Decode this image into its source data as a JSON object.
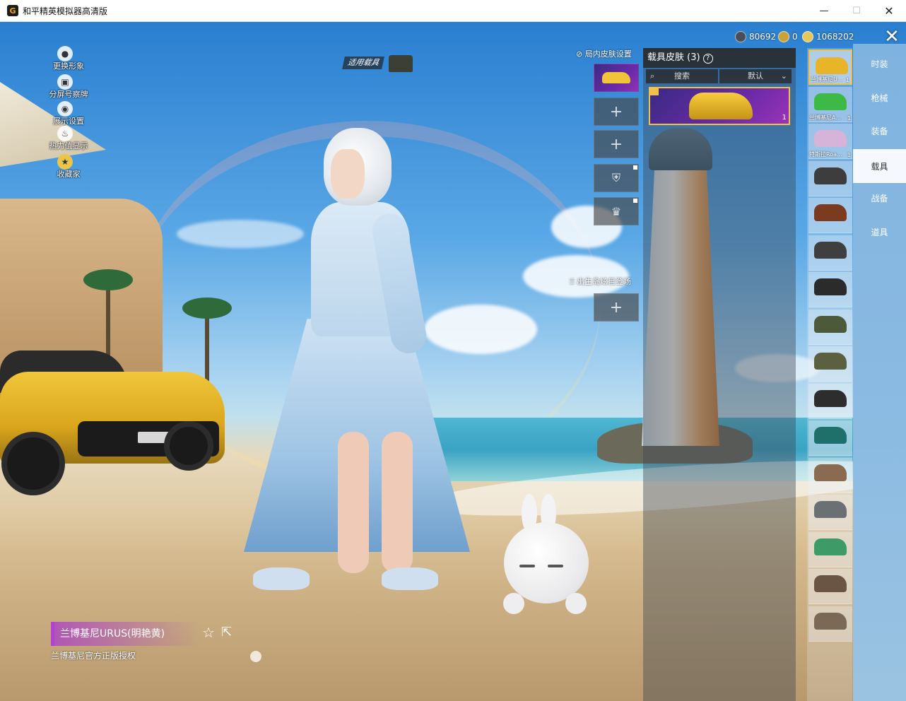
{
  "window": {
    "title": "和平精英模拟器高清版",
    "app_icon_glyph": "G",
    "minimize_glyph": "—",
    "maximize_glyph": "☐",
    "close_glyph": "✕"
  },
  "left_menu": [
    {
      "label": "更换形象",
      "icon": "person-icon"
    },
    {
      "label": "分屏号察牌",
      "icon": "display-icon"
    },
    {
      "label": "展示设置",
      "icon": "eye-icon"
    },
    {
      "label": "热力值显示",
      "icon": "flame-icon"
    },
    {
      "label": "收藏家",
      "icon": "collector-icon"
    }
  ],
  "apply_vehicle_tag": "适用载具",
  "currency": {
    "currency_1": "80692",
    "currency_2": "0",
    "currency_3": "1068202"
  },
  "slots": {
    "header": "局内皮肤设置",
    "birth_header": "出生岛炫目登场",
    "plus_glyph": "+"
  },
  "skin_panel": {
    "title": "载具皮肤 (3)",
    "help_glyph": "?",
    "search_label": "搜索",
    "sort_label": "默认",
    "selected_count": "1"
  },
  "vehicle_list": [
    {
      "label": "兰博基尼U...",
      "count": "1",
      "color": "#e8b52a",
      "selected": true
    },
    {
      "label": "兰博基尼A...",
      "count": "1",
      "color": "#3cba45"
    },
    {
      "label": "特斯拉Roa...",
      "count": "1",
      "color": "#d6b3d8"
    },
    {
      "label": "",
      "count": "",
      "color": "#3d3d3d"
    },
    {
      "label": "",
      "count": "",
      "color": "#7a3b1f"
    },
    {
      "label": "",
      "count": "",
      "color": "#3f3f3f"
    },
    {
      "label": "",
      "count": "",
      "color": "#2b2b2b"
    },
    {
      "label": "",
      "count": "",
      "color": "#4c5a3a"
    },
    {
      "label": "",
      "count": "",
      "color": "#5a6040"
    },
    {
      "label": "",
      "count": "",
      "color": "#2d2d2d"
    },
    {
      "label": "",
      "count": "",
      "color": "#1f6f6a"
    },
    {
      "label": "",
      "count": "",
      "color": "#8a6a50"
    },
    {
      "label": "",
      "count": "",
      "color": "#6b7075"
    },
    {
      "label": "",
      "count": "",
      "color": "#3e9a66"
    },
    {
      "label": "",
      "count": "",
      "color": "#6a5544"
    },
    {
      "label": "",
      "count": "",
      "color": "#7a6a55"
    }
  ],
  "categories": [
    {
      "label": "时装"
    },
    {
      "label": "枪械"
    },
    {
      "label": "装备"
    },
    {
      "label": "载具",
      "active": true
    },
    {
      "label": "战备"
    },
    {
      "label": "道具"
    }
  ],
  "item": {
    "name": "兰博基尼URUS(明艳黄)",
    "subtitle": "兰博基尼官方正版授权",
    "fav_glyph": "☆",
    "share_glyph": "⇱"
  },
  "colors": {
    "accent_gold": "#f3c14b",
    "rarity_purple": "#b440d6",
    "active_tab_bg": "#ffffff"
  }
}
